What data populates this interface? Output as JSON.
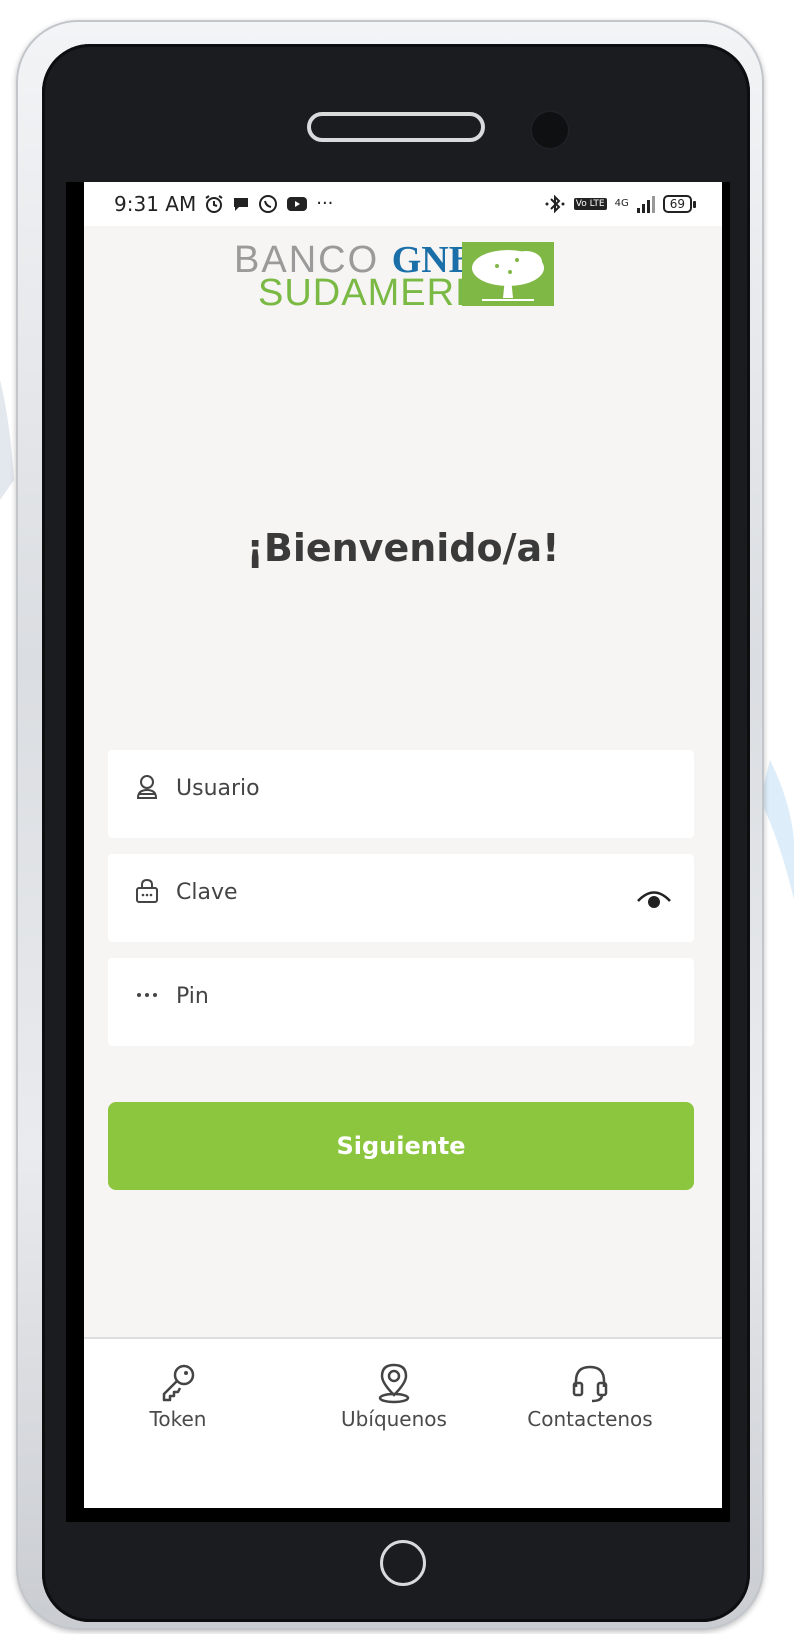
{
  "status_bar": {
    "time": "9:31 AM",
    "left_icons": [
      "alarm-icon",
      "chat-bubble-icon",
      "whatsapp-icon",
      "youtube-icon"
    ],
    "more": "···",
    "bluetooth_icon": "bluetooth-icon",
    "volte": "Vo LTE",
    "network": "4G",
    "battery": "69"
  },
  "logo": {
    "line1_a": "BANCO ",
    "line1_b": "GNB",
    "line2": "SUDAMERIS",
    "tree_icon": "tree-icon"
  },
  "welcome_title": "¡Bienvenido/a!",
  "form": {
    "usuario": {
      "placeholder": "Usuario",
      "value": "",
      "icon": "user-icon"
    },
    "clave": {
      "placeholder": "Clave",
      "value": "",
      "icon": "lock-icon",
      "toggle_icon": "eye-icon"
    },
    "pin": {
      "placeholder": "Pin",
      "value": "",
      "icon": "dots-icon"
    },
    "submit_label": "Siguiente"
  },
  "bottom_nav": {
    "items": [
      {
        "label": "Token",
        "icon": "key-icon"
      },
      {
        "label": "Ubíquenos",
        "icon": "location-pin-icon"
      },
      {
        "label": "Contactenos",
        "icon": "headset-icon"
      }
    ]
  },
  "colors": {
    "accent_green": "#8cc63f",
    "brand_blue": "#1b6fa8",
    "brand_green": "#79b944",
    "screen_bg": "#f6f5f4"
  }
}
